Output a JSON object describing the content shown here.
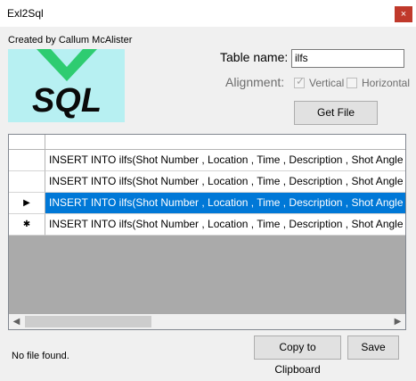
{
  "window": {
    "title": "Exl2Sql",
    "close_icon": "×"
  },
  "header": {
    "creator_text": "Created by Callum McAlister",
    "logo_text": "SQL"
  },
  "form": {
    "table_label": "Table name:",
    "table_value": "ilfs",
    "alignment_label": "Alignment:",
    "vertical_label": "Vertical",
    "vertical_checked": true,
    "horizontal_label": "Horizontal",
    "horizontal_checked": false,
    "get_file": "Get File"
  },
  "grid": {
    "rows": [
      {
        "indicator": "",
        "text": "INSERT INTO ilfs(Shot Number , Location , Time , Description , Shot Angle , Shot Type",
        "selected": false
      },
      {
        "indicator": "",
        "text": "INSERT INTO ilfs(Shot Number , Location , Time , Description , Shot Angle , Shot Type",
        "selected": false
      },
      {
        "indicator": "▶",
        "text": "INSERT INTO ilfs(Shot Number , Location , Time , Description , Shot Angle , Shot Type",
        "selected": true
      },
      {
        "indicator": "✱",
        "text": "INSERT INTO ilfs(Shot Number , Location , Time , Description , Shot Angle , Shot Type",
        "selected": false
      }
    ],
    "scroll_left_icon": "◀",
    "scroll_right_icon": "▶"
  },
  "footer": {
    "copy_label": "Copy to Clipboard",
    "save_label": "Save",
    "status": "No file found."
  },
  "colors": {
    "selection": "#0078d7",
    "logo_bg": "#b7f0f2",
    "logo_green": "#2ecc71",
    "close": "#c0392b"
  }
}
